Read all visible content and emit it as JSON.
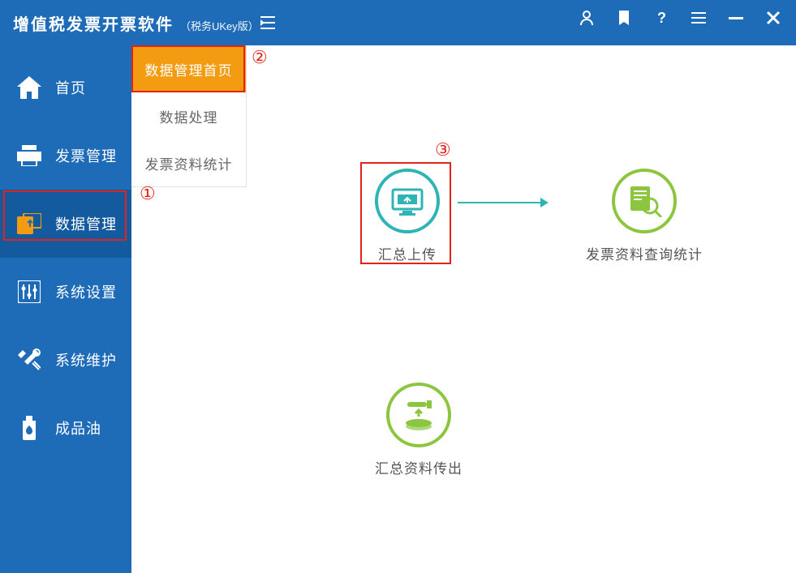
{
  "header": {
    "title": "增值税发票开票软件",
    "subtitle": "（税务UKey版）"
  },
  "sidebar": {
    "items": [
      {
        "label": "首页"
      },
      {
        "label": "发票管理"
      },
      {
        "label": "数据管理"
      },
      {
        "label": "系统设置"
      },
      {
        "label": "系统维护"
      },
      {
        "label": "成品油"
      }
    ]
  },
  "submenu": {
    "items": [
      {
        "label": "数据管理首页"
      },
      {
        "label": "数据处理"
      },
      {
        "label": "发票资料统计"
      }
    ]
  },
  "content": {
    "func1_label": "汇总上传",
    "func2_label": "发票资料查询统计",
    "func3_label": "汇总资料传出"
  },
  "annotations": {
    "n1": "①",
    "n2": "②",
    "n3": "③"
  }
}
